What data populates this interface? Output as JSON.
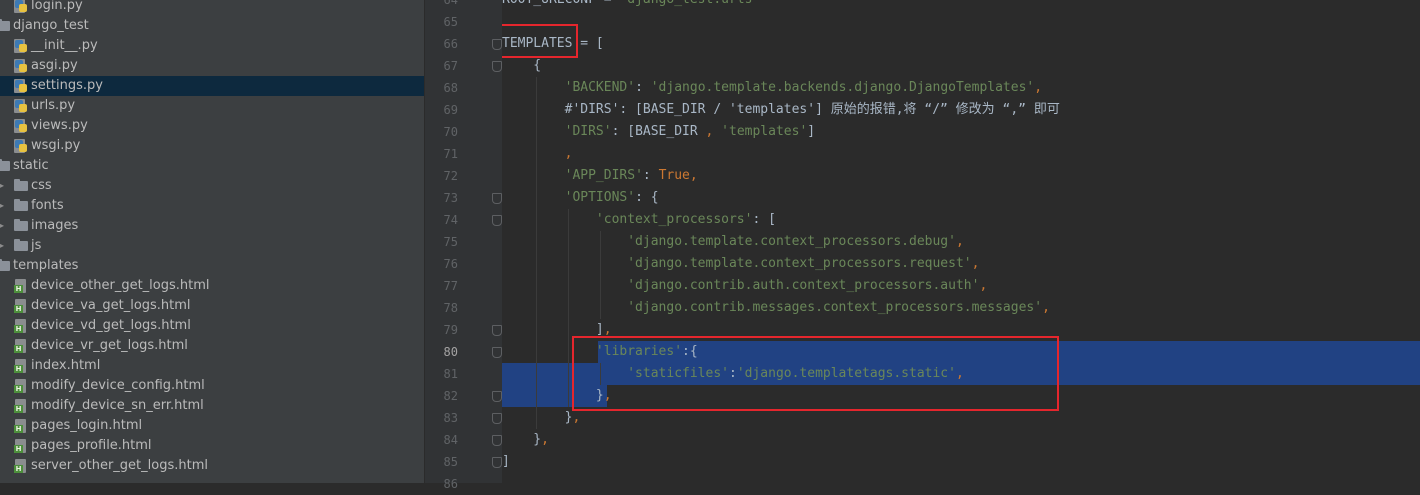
{
  "project_tree": {
    "items": [
      {
        "label": "login.py",
        "type": "py",
        "indent": 2
      },
      {
        "label": "django_test",
        "type": "folder",
        "indent": 1,
        "expanded": true
      },
      {
        "label": "__init__.py",
        "type": "py",
        "indent": 2
      },
      {
        "label": "asgi.py",
        "type": "py",
        "indent": 2
      },
      {
        "label": "settings.py",
        "type": "py",
        "indent": 2,
        "selected": true
      },
      {
        "label": "urls.py",
        "type": "py",
        "indent": 2
      },
      {
        "label": "views.py",
        "type": "py",
        "indent": 2
      },
      {
        "label": "wsgi.py",
        "type": "py",
        "indent": 2
      },
      {
        "label": "static",
        "type": "folder",
        "indent": 1,
        "expanded": true
      },
      {
        "label": "css",
        "type": "folder",
        "indent": 2,
        "expanded": false
      },
      {
        "label": "fonts",
        "type": "folder",
        "indent": 2,
        "expanded": false
      },
      {
        "label": "images",
        "type": "folder",
        "indent": 2,
        "expanded": false
      },
      {
        "label": "js",
        "type": "folder",
        "indent": 2,
        "expanded": false
      },
      {
        "label": "templates",
        "type": "folder",
        "indent": 1,
        "expanded": true
      },
      {
        "label": "device_other_get_logs.html",
        "type": "html",
        "indent": 2
      },
      {
        "label": "device_va_get_logs.html",
        "type": "html",
        "indent": 2
      },
      {
        "label": "device_vd_get_logs.html",
        "type": "html",
        "indent": 2
      },
      {
        "label": "device_vr_get_logs.html",
        "type": "html",
        "indent": 2
      },
      {
        "label": "index.html",
        "type": "html",
        "indent": 2
      },
      {
        "label": "modify_device_config.html",
        "type": "html",
        "indent": 2
      },
      {
        "label": "modify_device_sn_err.html",
        "type": "html",
        "indent": 2
      },
      {
        "label": "pages_login.html",
        "type": "html",
        "indent": 2
      },
      {
        "label": "pages_profile.html",
        "type": "html",
        "indent": 2
      },
      {
        "label": "server_other_get_logs.html",
        "type": "html",
        "indent": 2
      }
    ]
  },
  "editor": {
    "current_line": 80,
    "lines": [
      {
        "num": 64,
        "parts": [
          [
            "t",
            "ROOT_URLCONF = "
          ],
          [
            "s",
            "'django_test.urls'"
          ]
        ]
      },
      {
        "num": 65,
        "parts": []
      },
      {
        "num": 66,
        "parts": [
          [
            "t",
            "TEMPLATES = ["
          ]
        ]
      },
      {
        "num": 67,
        "parts": [
          [
            "t",
            "    {"
          ]
        ]
      },
      {
        "num": 68,
        "parts": [
          [
            "t",
            "        "
          ],
          [
            "s",
            "'BACKEND'"
          ],
          [
            "t",
            ": "
          ],
          [
            "s",
            "'django.template.backends.django.DjangoTemplates'"
          ],
          [
            "k",
            ","
          ]
        ]
      },
      {
        "num": 69,
        "parts": [
          [
            "t",
            "        #'DIRS': [BASE_DIR / 'templates'] 原始的报错,将 “/” 修改为 “,” 即可"
          ]
        ]
      },
      {
        "num": 70,
        "parts": [
          [
            "t",
            "        "
          ],
          [
            "s",
            "'DIRS'"
          ],
          [
            "t",
            ": [BASE_DIR "
          ],
          [
            "k",
            ","
          ],
          [
            "t",
            " "
          ],
          [
            "s",
            "'templates'"
          ],
          [
            "t",
            "]"
          ]
        ]
      },
      {
        "num": 71,
        "parts": [
          [
            "t",
            "        "
          ],
          [
            "k",
            ","
          ]
        ]
      },
      {
        "num": 72,
        "parts": [
          [
            "t",
            "        "
          ],
          [
            "s",
            "'APP_DIRS'"
          ],
          [
            "t",
            ": "
          ],
          [
            "k",
            "True,"
          ]
        ]
      },
      {
        "num": 73,
        "parts": [
          [
            "t",
            "        "
          ],
          [
            "s",
            "'OPTIONS'"
          ],
          [
            "t",
            ": {"
          ]
        ]
      },
      {
        "num": 74,
        "parts": [
          [
            "t",
            "            "
          ],
          [
            "s",
            "'context_processors'"
          ],
          [
            "t",
            ": ["
          ]
        ]
      },
      {
        "num": 75,
        "parts": [
          [
            "t",
            "                "
          ],
          [
            "s",
            "'django.template.context_processors.debug'"
          ],
          [
            "k",
            ","
          ]
        ]
      },
      {
        "num": 76,
        "parts": [
          [
            "t",
            "                "
          ],
          [
            "s",
            "'django.template.context_processors.request'"
          ],
          [
            "k",
            ","
          ]
        ]
      },
      {
        "num": 77,
        "parts": [
          [
            "t",
            "                "
          ],
          [
            "s",
            "'django.contrib.auth.context_processors.auth'"
          ],
          [
            "k",
            ","
          ]
        ]
      },
      {
        "num": 78,
        "parts": [
          [
            "t",
            "                "
          ],
          [
            "s",
            "'django.contrib.messages.context_processors.messages'"
          ],
          [
            "k",
            ","
          ]
        ]
      },
      {
        "num": 79,
        "parts": [
          [
            "t",
            "            ]"
          ],
          [
            "k",
            ","
          ]
        ]
      },
      {
        "num": 80,
        "parts": [
          [
            "t",
            "            "
          ],
          [
            "s",
            "'libraries'"
          ],
          [
            "t",
            ":{"
          ]
        ]
      },
      {
        "num": 81,
        "parts": [
          [
            "t",
            "                "
          ],
          [
            "s",
            "'staticfiles'"
          ],
          [
            "t",
            ":"
          ],
          [
            "s",
            "'django.templatetags.static'"
          ],
          [
            "k",
            ","
          ]
        ]
      },
      {
        "num": 82,
        "parts": [
          [
            "t",
            "            }"
          ],
          [
            "k",
            ","
          ]
        ]
      },
      {
        "num": 83,
        "parts": [
          [
            "t",
            "        }"
          ],
          [
            "k",
            ","
          ]
        ]
      },
      {
        "num": 84,
        "parts": [
          [
            "t",
            "    }"
          ],
          [
            "k",
            ","
          ]
        ]
      },
      {
        "num": 85,
        "parts": [
          [
            "t",
            "]"
          ]
        ]
      },
      {
        "num": 86,
        "parts": []
      }
    ]
  },
  "colors": {
    "string": "#6a8759",
    "keyword": "#cc7832",
    "text": "#a9b7c6",
    "selection": "#214283",
    "annotation_box": "#e5262d"
  }
}
